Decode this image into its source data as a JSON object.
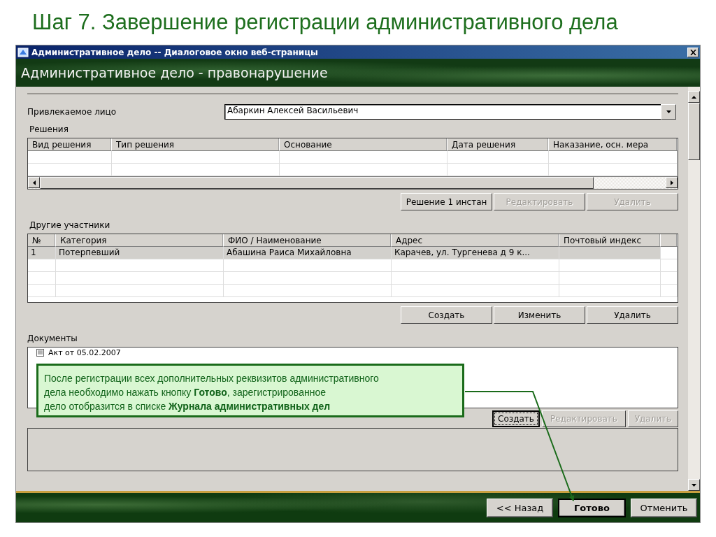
{
  "slide_title": "Шаг 7. Завершение регистрации административного дела",
  "window": {
    "title": "Административное дело -- Диалоговое окно веб-страницы",
    "header": "Административное дело - правонарушение"
  },
  "person": {
    "label": "Привлекаемое лицо",
    "value": "Абаркин Алексей Васильевич"
  },
  "decisions": {
    "label": "Решения",
    "columns": [
      "Вид решения",
      "Тип решения",
      "Основание",
      "Дата решения",
      "Наказание, осн. мера"
    ],
    "buttons": [
      {
        "label": "Решение 1 инстан",
        "disabled": false
      },
      {
        "label": "Редактировать",
        "disabled": true
      },
      {
        "label": "Удалить",
        "disabled": true
      }
    ]
  },
  "participants": {
    "label": "Другие участники",
    "columns": [
      "№",
      "Категория",
      "ФИО / Наименование",
      "Адрес",
      "Почтовый индекс"
    ],
    "rows": [
      {
        "cells": [
          "1",
          "Потерпевший",
          "Абашина Раиса Михайловна",
          "Карачев, ул. Тургенева д 9 к..."
        ],
        "selected": true
      }
    ],
    "buttons": [
      {
        "label": "Создать",
        "disabled": false
      },
      {
        "label": "Изменить",
        "disabled": false
      },
      {
        "label": "Удалить",
        "disabled": false
      }
    ]
  },
  "documents": {
    "label": "Документы",
    "items": [
      {
        "label": "Акт от 05.02.2007"
      }
    ],
    "buttons": [
      {
        "label": "Создать",
        "disabled": false
      },
      {
        "label": "Редактировать",
        "disabled": true
      },
      {
        "label": "Удалить",
        "disabled": true
      }
    ]
  },
  "callout": {
    "text": "После регистрации всех дополнительных реквизитов административного\nдела необходимо нажать кнопку **Готово**, зарегистрированное\nдело отобразится в списке **Журнала административных дел**"
  },
  "footer_buttons": [
    {
      "label": "<< Назад",
      "default": false
    },
    {
      "label": "Готово",
      "default": true
    },
    {
      "label": "Отменить",
      "default": false
    }
  ]
}
